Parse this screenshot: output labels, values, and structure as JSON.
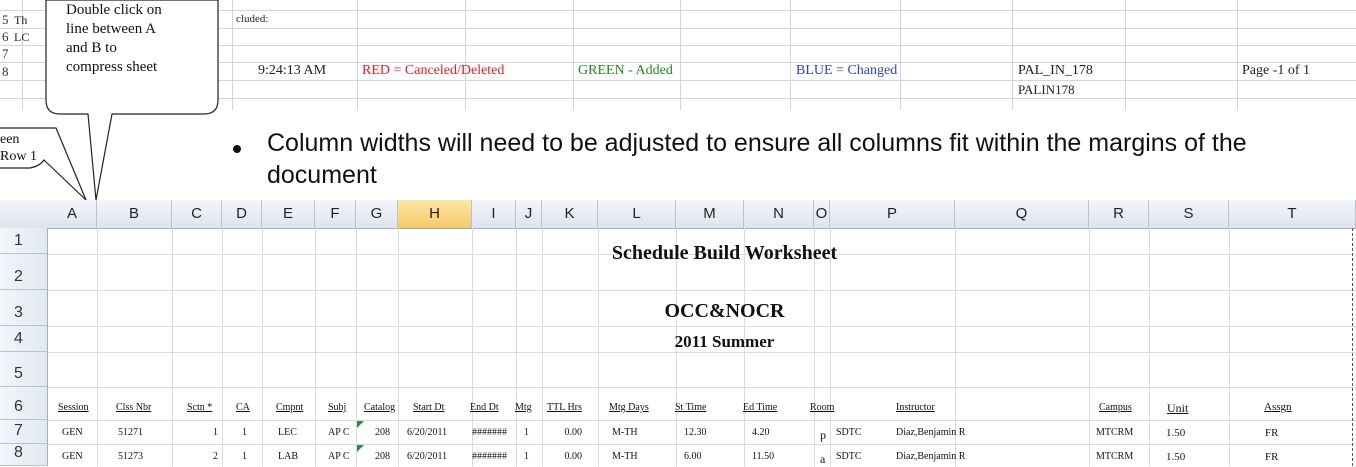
{
  "callouts": {
    "compress": {
      "lines": [
        "Double click on",
        "line between A",
        "and B to",
        "compress sheet"
      ]
    },
    "partial": {
      "lines": [
        "een",
        "Row 1"
      ]
    }
  },
  "top_sheet": {
    "rows": [
      "5",
      "6",
      "7",
      "8"
    ],
    "row5_fragment": "Th",
    "row5_text": "cluded:",
    "row6_fragment": "LC",
    "time": "9:24:13 AM",
    "red_legend": "RED = Canceled/Deleted",
    "green_legend": "GREEN - Added",
    "blue_legend": "BLUE = Changed",
    "report_id_1": "PAL_IN_178",
    "report_id_2": "PALIN178",
    "page_label": "Page -1 of 1",
    "colors": {
      "red": "#e02020",
      "green": "#1e8a1e",
      "blue": "#2a3fd0"
    }
  },
  "bullet": {
    "text": "Column widths will need to be adjusted to ensure all columns fit within the margins of the document"
  },
  "grid": {
    "columns": [
      "A",
      "B",
      "C",
      "D",
      "E",
      "F",
      "G",
      "H",
      "I",
      "J",
      "K",
      "L",
      "M",
      "N",
      "O",
      "P",
      "Q",
      "R",
      "S",
      "T"
    ],
    "selected_column": "H",
    "row_numbers": [
      "1",
      "2",
      "3",
      "4",
      "5",
      "6",
      "7",
      "8"
    ]
  },
  "titles": {
    "line1": "Schedule Build Worksheet",
    "line2": "OCC&NOCR",
    "line3": "2011 Summer"
  },
  "table": {
    "headers": [
      "Session",
      "Clss Nbr",
      "Sctn *",
      "CA",
      "Cmpnt",
      "Subj",
      "Catalog",
      "Start Dt",
      "End Dt",
      "Mtg",
      "TTL Hrs",
      "Mtg Days",
      "St Time",
      "Ed Time",
      "Room",
      "Instructor",
      "Campus",
      "Unit",
      "Assgn"
    ],
    "rows": [
      {
        "session": "GEN",
        "clss": "51271",
        "sctn": "1",
        "ca": "1",
        "cmpnt": "LEC",
        "subj": "AP C",
        "catalog": "208",
        "start": "6/20/2011",
        "end": "#######",
        "mtg": "1",
        "ttl": "0.00",
        "days": "M-TH",
        "st": "12.30",
        "ed": "4.20",
        "ap": "p",
        "room": "SDTC",
        "instr": "Diaz,Benjamin R",
        "campus": "MTCRM",
        "unit": "1.50",
        "assgn": "FR"
      },
      {
        "session": "GEN",
        "clss": "51273",
        "sctn": "2",
        "ca": "1",
        "cmpnt": "LAB",
        "subj": "AP C",
        "catalog": "208",
        "start": "6/20/2011",
        "end": "#######",
        "mtg": "1",
        "ttl": "0.00",
        "days": "M-TH",
        "st": "6.00",
        "ed": "11.50",
        "ap": "a",
        "room": "SDTC",
        "instr": "Diaz,Benjamin R",
        "campus": "MTCRM",
        "unit": "1.50",
        "assgn": "FR"
      }
    ]
  }
}
